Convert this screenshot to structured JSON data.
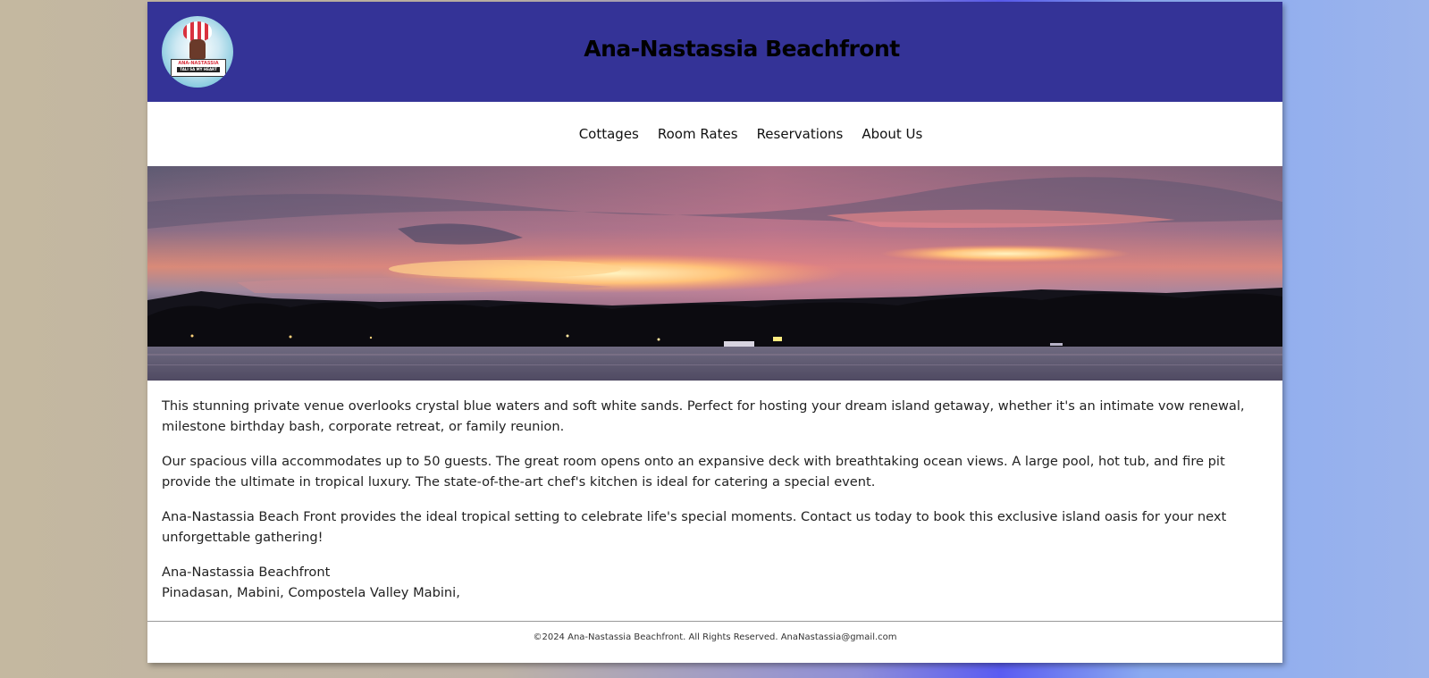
{
  "header": {
    "logo_text": "ANA-NASTASSIA",
    "logo_subtext": "TALI SA MY HEART",
    "title": "Ana-Nastassia Beachfront"
  },
  "nav": {
    "items": [
      {
        "label": "Cottages"
      },
      {
        "label": "Room Rates"
      },
      {
        "label": "Reservations"
      },
      {
        "label": "About Us"
      }
    ]
  },
  "content": {
    "paragraphs": [
      "This stunning private venue overlooks crystal blue waters and soft white sands. Perfect for hosting your dream island getaway, whether it's an intimate vow renewal, milestone birthday bash, corporate retreat, or family reunion.",
      "Our spacious villa accommodates up to 50 guests. The great room opens onto an expansive deck with breathtaking ocean views. A large pool, hot tub, and fire pit provide the ultimate in tropical luxury. The state-of-the-art chef's kitchen is ideal for catering a special event.",
      "Ana-Nastassia Beach Front provides the ideal tropical setting to celebrate life's special moments. Contact us today to book this exclusive island oasis for your next unforgettable gathering!"
    ],
    "address_line1": "Ana-Nastassia Beachfront",
    "address_line2": "Pinadasan, Mabini, Compostela Valley Mabini,"
  },
  "footer": {
    "text": "©2024 Ana-Nastassia Beachfront. All Rights Reserved. AnaNastassia@gmail.com"
  },
  "colors": {
    "header_bg": "#343397",
    "page_bg": "#ffffff"
  }
}
